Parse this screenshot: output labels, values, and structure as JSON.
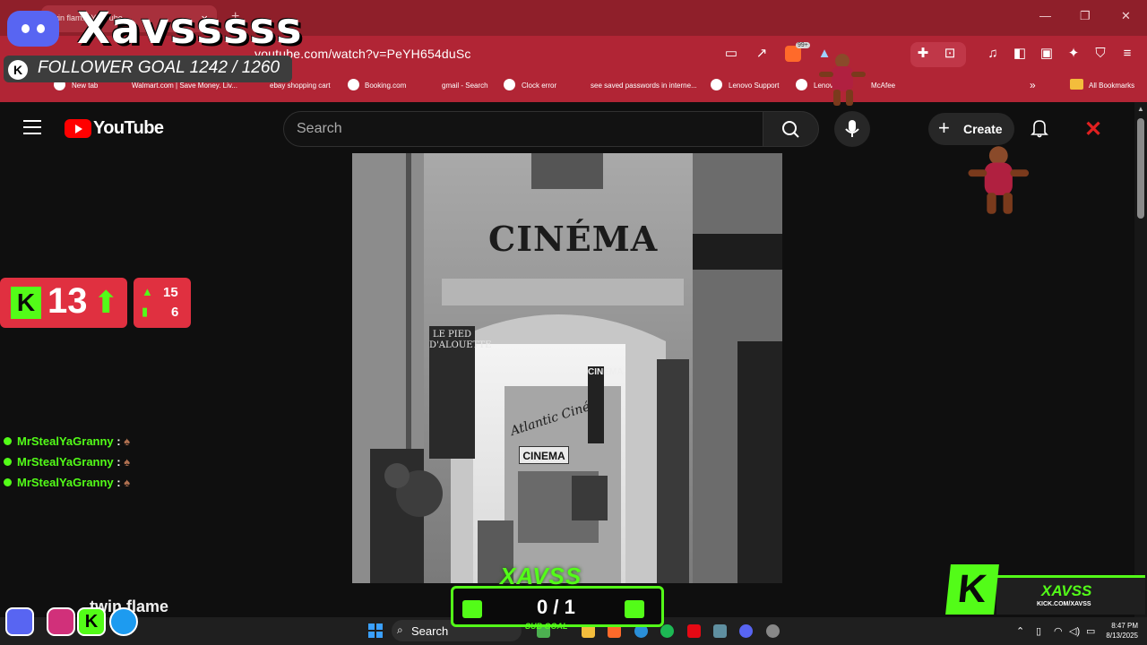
{
  "overlay": {
    "channel_name": "Xavsssss",
    "follower_goal": "FOLLOWER GOAL 1242 / 1260",
    "kick_badge": "K",
    "kick_count": "13",
    "stat_up": "15",
    "stat_bars": "6",
    "chat": [
      {
        "user": "MrStealYaGranny",
        "sep": ":"
      },
      {
        "user": "MrStealYaGranny",
        "sep": ":"
      },
      {
        "user": "MrStealYaGranny",
        "sep": ":"
      }
    ],
    "sub_goal_count": "0 / 1",
    "sub_goal_label": "SUB GOAL",
    "logo_text": "XAVSS",
    "brand_name": "XAVSS",
    "brand_url": "KICK.COM/XAVSS"
  },
  "browser": {
    "tab_title": "twin flam... YouTube",
    "url": "youtube.com/watch?v=PeYH654duSc",
    "brave_badge": "99+",
    "bookmarks": [
      "New tab",
      "Walmart.com | Save Money. Liv...",
      "ebay shopping cart",
      "Booking.com",
      "gmail - Search",
      "Clock error",
      "see saved passwords in interne...",
      "Lenovo Support",
      "Lenovo",
      "McAfee"
    ],
    "all_bookmarks": "All Bookmarks"
  },
  "youtube": {
    "wordmark": "YouTube",
    "search_placeholder": "Search",
    "create_label": "Create",
    "video_title": "twin flame"
  },
  "video_art": {
    "main_sign": "CINÉMA",
    "pied_sign": "LE PIED D'ALOUETTE",
    "small_sign": "CINEMA",
    "vertical_sign": "CINEMA",
    "atlantic": "Atlantic Ciné"
  },
  "taskbar": {
    "search_label": "Search",
    "time": "8:47 PM",
    "date": "8/13/2025"
  },
  "colors": {
    "browser_chrome": "#b12535",
    "kick_green": "#53fc18",
    "overlay_red": "#e03040",
    "youtube_bg": "#0f0f0f"
  }
}
